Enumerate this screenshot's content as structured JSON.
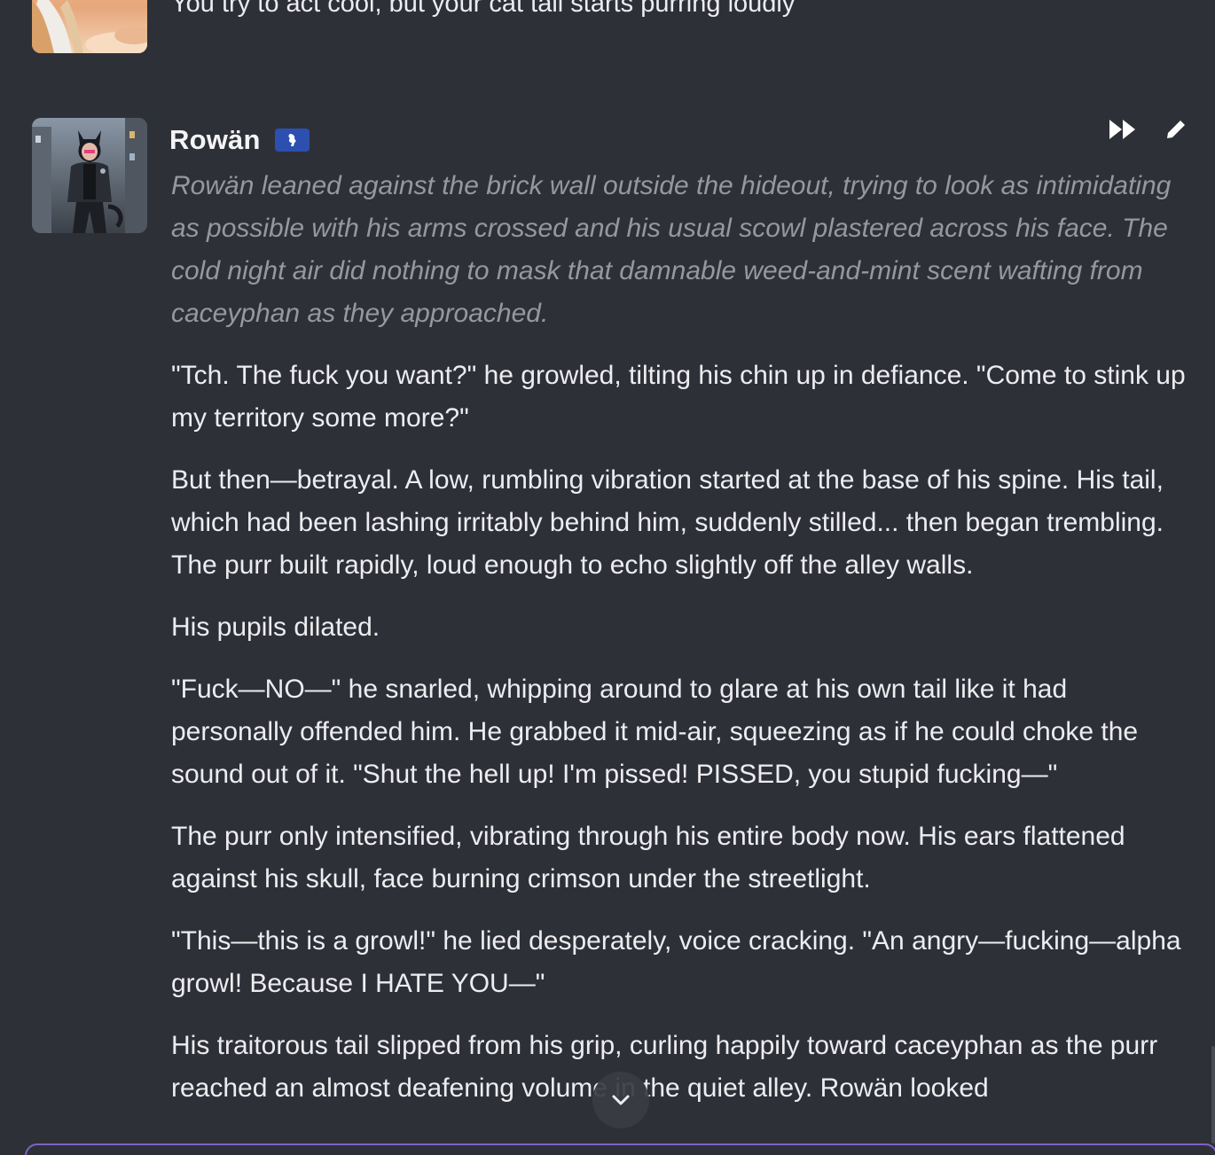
{
  "previous_message": {
    "text": "You try to act cool, but your cat tail starts purring loudly"
  },
  "message": {
    "author": "Rowän",
    "badge_icon": "seal-icon",
    "actions": [
      {
        "icon": "fast-forward-icon"
      },
      {
        "icon": "pencil-edit-icon"
      }
    ],
    "paragraphs": [
      "Rowän leaned against the brick wall outside the hideout, trying to look as intimidating as possible with his arms crossed and his usual scowl plastered across his face. The cold night air did nothing to mask that damnable weed-and-mint scent wafting from caceyphan as they approached.",
      "\"Tch. The fuck you want?\" he growled, tilting his chin up in defiance. \"Come to stink up my territory some more?\"",
      "But then—betrayal. A low, rumbling vibration started at the base of his spine. His tail, which had been lashing irritably behind him, suddenly stilled... then began trembling. The purr built rapidly, loud enough to echo slightly off the alley walls.",
      "His pupils dilated.",
      "\"Fuck—NO—\" he snarled, whipping around to glare at his own tail like it had personally offended him. He grabbed it mid-air, squeezing as if he could choke the sound out of it. \"Shut the hell up! I'm pissed! PISSED, you stupid fucking—\"",
      "The purr only intensified, vibrating through his entire body now. His ears flattened against his skull, face burning crimson under the streetlight.",
      "\"This—this is a growl!\" he lied desperately, voice cracking. \"An angry—fucking—alpha growl! Because I HATE YOU—\"",
      "His traitorous tail slipped from his grip, curling happily toward caceyphan as the purr reached an almost deafening volume in the quiet alley. Rowän looked"
    ]
  },
  "scroll_button": {
    "icon": "chevron-down-icon"
  },
  "colors": {
    "background": "#2e3038",
    "text": "#ededf0",
    "narration": "#97979f",
    "badge": "#2c4fb0",
    "input_border": "#7e62c4"
  }
}
